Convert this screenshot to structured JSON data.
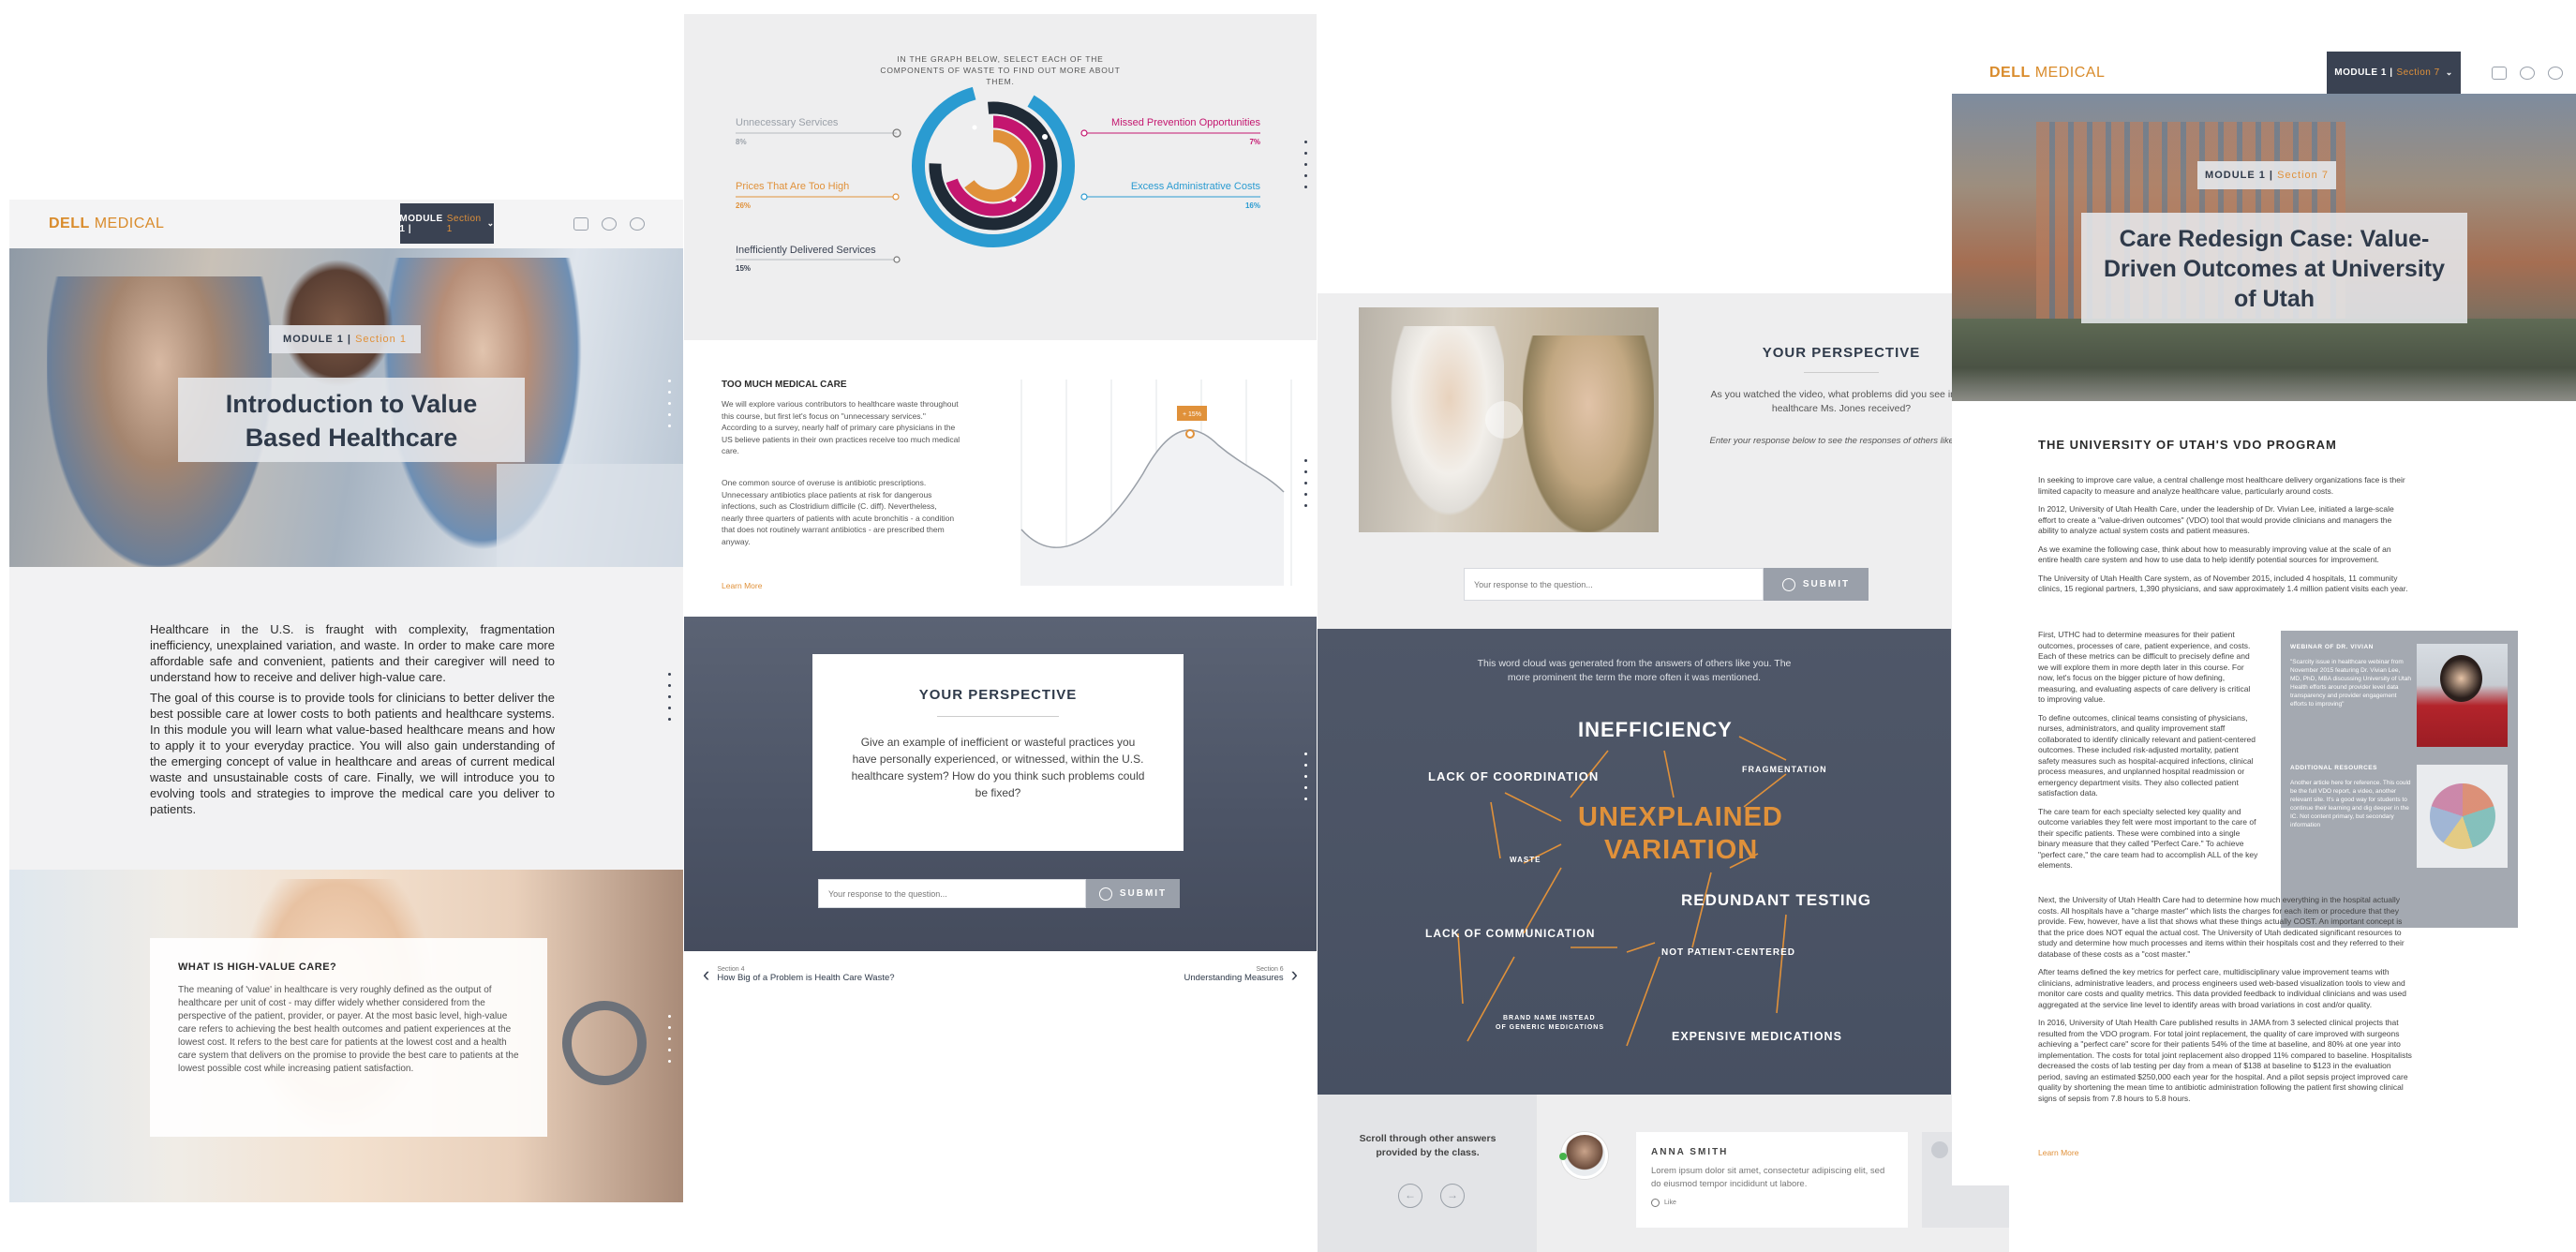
{
  "colors": {
    "accent": "#e0913a",
    "navy": "#3a4252",
    "slate": "#4d5566",
    "magenta": "#c4166f",
    "blue": "#2a9bd1"
  },
  "panel1": {
    "brand_dell": "DELL",
    "brand_medical": " MEDICAL",
    "module_label": "MODULE 1 |",
    "section_label": "Section 1",
    "title": "Introduction to Value Based Healthcare",
    "para1": "Healthcare in the U.S. is fraught with complexity, fragmentation inefficiency, unexplained variation, and waste. In order to make care more affordable safe and convenient, patients and their caregiver will need to understand how to receive and deliver high-value care.",
    "para2": "The goal of this course is to provide tools for clinicians to better deliver the best possible care at lower costs to both patients and healthcare systems. In this module you will learn what value-based healthcare means and how to apply it to your everyday practice. You will also gain understanding of the emerging concept of value in healthcare and areas of current medical waste and unsustainable costs of care. Finally, we will introduce you to evolving tools and strategies to improve the medical care you deliver to patients.",
    "hv_title": "WHAT IS HIGH-VALUE CARE?",
    "hv_body": "The meaning of 'value' in healthcare is very roughly defined as the output of healthcare per unit of cost - may differ widely whether considered from the perspective of the patient, provider, or payer. At the most basic level, high-value care refers to achieving the best health outcomes and patient experiences at the lowest cost. It refers to the best care for patients at the lowest cost and a health care system that delivers on the promise to provide the best care to patients at the lowest possible cost while increasing patient satisfaction."
  },
  "panel2": {
    "instruction": "IN THE GRAPH BELOW, SELECT EACH OF THE COMPONENTS OF WASTE TO FIND OUT MORE ABOUT THEM.",
    "waste": [
      {
        "label": "Unnecessary Services",
        "pct": "8%"
      },
      {
        "label": "Prices That Are Too High",
        "pct": "26%"
      },
      {
        "label": "Inefficiently Delivered Services",
        "pct": "15%"
      },
      {
        "label": "Missed Prevention Opportunities",
        "pct": "7%"
      },
      {
        "label": "Excess Administrative Costs",
        "pct": "16%"
      }
    ],
    "tmc_title": "TOO MUCH MEDICAL CARE",
    "tmc_body1": "We will explore various contributors to healthcare waste throughout this course, but first let's focus on \"unnecessary services.\" According to a survey, nearly half of primary care physicians in the US believe patients in their own practices receive too much medical care.",
    "tmc_body2": "One common source of overuse is antibiotic prescriptions. Unnecessary antibiotics place patients at risk for dangerous infections, such as Clostridium difficile (C. diff). Nevertheless, nearly three quarters of patients with acute bronchitis - a condition that does not routinely warrant antibiotics - are prescribed them anyway.",
    "learn_more": "Learn More",
    "bubble": "+ 15%",
    "persp_title": "YOUR PERSPECTIVE",
    "persp_q": "Give an example of inefficient or wasteful practices you have personally experienced, or witnessed, within the U.S. healthcare system? How do you think such problems could be fixed?",
    "resp_placeholder": "Your response to the question...",
    "submit": "SUBMIT",
    "prev_sec": "Section 4",
    "prev_title": "How Big of a Problem is Health Care Waste?",
    "next_sec": "Section 6",
    "next_title": "Understanding Measures"
  },
  "panel3": {
    "persp_title": "YOUR PERSPECTIVE",
    "persp_q": "As you watched the video, what problems did you see in the healthcare Ms. Jones received?",
    "persp_hint": "Enter your response below to see the responses of others like you.",
    "resp_placeholder": "Your response to the question...",
    "submit": "SUBMIT",
    "cloud_intro": "This word cloud was generated from the answers of others like you. The more prominent the term the more often it was mentioned.",
    "words": [
      "INEFFICIENCY",
      "LACK OF COORDINATION",
      "FRAGMENTATION",
      "UNEXPLAINED",
      "VARIATION",
      "WASTE",
      "REDUNDANT TESTING",
      "LACK OF COMMUNICATION",
      "NOT PATIENT-CENTERED",
      "BRAND NAME INSTEAD",
      "OF GENERIC MEDICATIONS",
      "EXPENSIVE MEDICATIONS"
    ],
    "scroll_text": "Scroll through other answers provided by the class.",
    "commenter": "ANNA SMITH",
    "comment": "Lorem ipsum dolor sit amet, consectetur adipiscing elit, sed do eiusmod tempor incididunt ut labore.",
    "like": "Like"
  },
  "panel4": {
    "brand_dell": "DELL",
    "brand_medical": " MEDICAL",
    "module_label": "MODULE 1 |",
    "section_label": "Section 7",
    "title": "Care Redesign Case: Value-Driven Outcomes at University of Utah",
    "program_title": "THE UNIVERSITY OF UTAH'S VDO PROGRAM",
    "paras": [
      "In seeking to improve care value, a central challenge most healthcare delivery organizations face is their limited capacity to measure and analyze healthcare value, particularly around costs.",
      "In 2012, University of Utah Health Care, under the leadership of Dr. Vivian Lee, initiated a large-scale effort to create a \"value-driven outcomes\" (VDO) tool that would provide clinicians and managers the ability to analyze actual system costs and patient measures.",
      "As we examine the following case, think about how to measurably improving value at the scale of an entire health care system and how to use data to help identify potential sources for improvement.",
      "The University of Utah Health Care system, as of November 2015, included 4 hospitals, 11 community clinics, 15 regional partners, 1,390 physicians, and saw approximately 1.4 million patient visits each year."
    ],
    "col_paras": [
      "First, UTHC had to determine measures for their patient outcomes, processes of care, patient experience, and costs. Each of these metrics can be difficult to precisely define and we will explore them in more depth later in this course. For now, let's focus on the bigger picture of how defining, measuring, and evaluating aspects of care delivery is critical to improving value.",
      "To define outcomes, clinical teams consisting of physicians, nurses, administrators, and quality improvement staff collaborated to identify clinically relevant and patient-centered outcomes. These included risk-adjusted mortality, patient safety measures such as hospital-acquired infections, clinical process measures, and unplanned hospital readmission or emergency department visits. They also collected patient satisfaction data.",
      "The care team for each specialty selected key quality and outcome variables they felt were most important to the care of their specific patients. These were combined into a single binary measure that they called \"Perfect Care.\" To achieve \"perfect care,\" the care team had to accomplish ALL of the key elements."
    ],
    "paras2": [
      "Next, the University of Utah Health Care had to determine how much everything in the hospital actually costs. All hospitals have a \"charge master\" which lists the charges for each item or procedure that they provide. Few, however, have a list that shows what these things actually COST. An important concept is that the price does NOT equal the actual cost. The University of Utah dedicated significant resources to study and determine how much processes and items within their hospitals cost and they referred to their database of these costs as a \"cost master.\"",
      "After teams defined the key metrics for perfect care, multidisciplinary value improvement teams with clinicians, administrative leaders, and process engineers used web-based visualization tools to view and monitor care costs and quality metrics. This data provided feedback to individual clinicians and was used aggregated at the service line level to identify areas with broad variations in cost and/or quality.",
      "In 2016, University of Utah Health Care published results in JAMA from 3 selected clinical projects that resulted from the VDO program. For total joint replacement, the quality of care improved with surgeons achieving a \"perfect care\" score for their patients 54% of the time at baseline, and 80% at one year into implementation. The costs for total joint replacement also dropped 11% compared to baseline. Hospitalists decreased the costs of lab testing per day from a mean of $138 at baseline to $123 in the evaluation period, saving an estimated $250,000 each year for the hospital. And a pilot sepsis project improved care quality by shortening the mean time to antibiotic administration following the patient first showing clinical signs of sepsis from 7.8 hours to 5.8 hours."
    ],
    "learn_more": "Learn More",
    "webinar_title": "WEBINAR OF DR. VIVIAN",
    "webinar_body": "\"Scarcity issue in healthcare webinar from November 2015 featuring Dr. Vivian Lee, MD, PhD, MBA discussing University of Utah Health efforts around provider level data transparency and provider engagement efforts to improving\"",
    "resources_title": "ADDITIONAL RESOURCES",
    "resources_body": "Another article here for reference. This could be the full VDO report, a video, another relevant site. It's a good way for students to continue their learning and dig deeper in the IC. Not content primary, but secondary information"
  }
}
